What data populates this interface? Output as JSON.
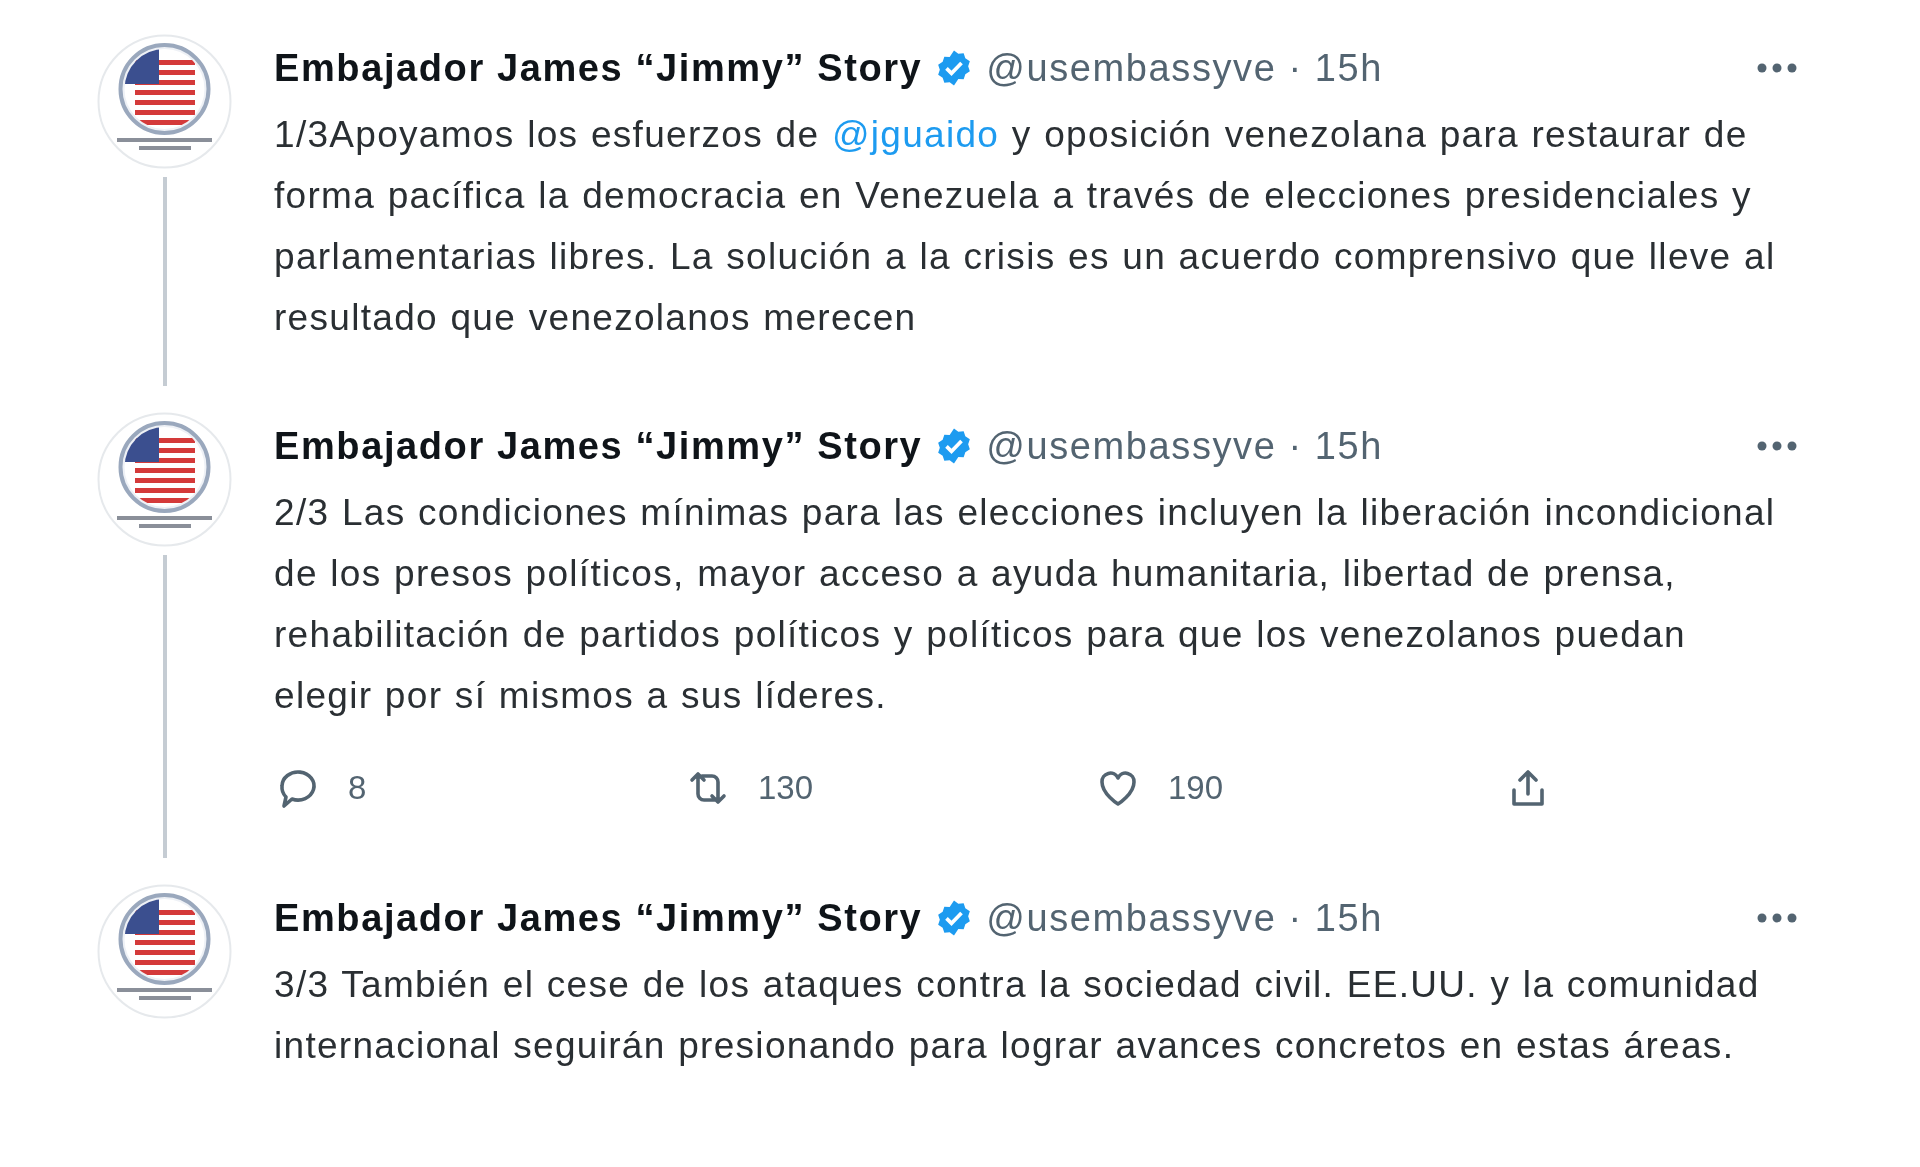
{
  "tweets": [
    {
      "name": "Embajador James “Jimmy” Story",
      "verified": true,
      "handle": "@usembassyve",
      "separator": "·",
      "time": "15h",
      "connected_below": true,
      "body": [
        {
          "kind": "text",
          "text": "1/3Apoyamos los esfuerzos de "
        },
        {
          "kind": "mention",
          "text": "@jguaido"
        },
        {
          "kind": "text",
          "text": " y oposición venezolana para restaurar de forma pacífica la democracia en Venezuela a través de elecciones presidenciales y parlamentarias libres. La solución a la crisis es un acuerdo comprensivo que lleve al resultado que venezolanos merecen"
        }
      ]
    },
    {
      "name": "Embajador James “Jimmy” Story",
      "verified": true,
      "handle": "@usembassyve",
      "separator": "·",
      "time": "15h",
      "connected_below": true,
      "body": [
        {
          "kind": "text",
          "text": "2/3 Las condiciones mínimas para las elecciones incluyen la liberación incondicional de los presos políticos, mayor acceso a ayuda humanitaria, libertad de prensa, rehabilitación de partidos políticos y políticos para que los venezolanos puedan elegir por sí mismos a sus líderes."
        }
      ],
      "actions": [
        {
          "kind": "reply",
          "count": "8"
        },
        {
          "kind": "retweet",
          "count": "130"
        },
        {
          "kind": "like",
          "count": "190"
        },
        {
          "kind": "share"
        }
      ]
    },
    {
      "name": "Embajador James “Jimmy” Story",
      "verified": true,
      "handle": "@usembassyve",
      "separator": "·",
      "time": "15h",
      "connected_below": false,
      "body": [
        {
          "kind": "text",
          "text": "3/3 También el cese de los ataques contra la sociedad civil. EE.UU. y la comunidad internacional seguirán presionando para lograr avances concretos en estas áreas."
        }
      ]
    }
  ]
}
